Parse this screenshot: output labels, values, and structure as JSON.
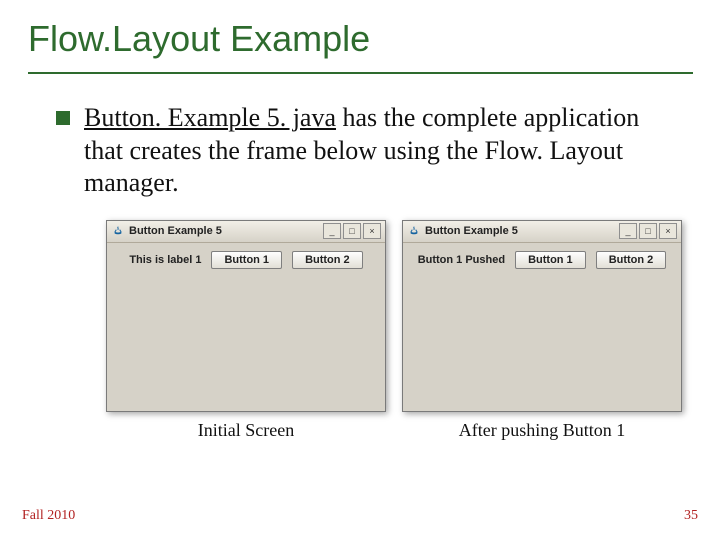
{
  "title": "Flow.Layout Example",
  "body": {
    "link_text": "Button. Example 5. java",
    "rest_text": " has the complete application that creates the frame below using the Flow. Layout manager."
  },
  "figures": {
    "left": {
      "window_title": "Button Example 5",
      "label": "This is label 1",
      "button1": "Button 1",
      "button2": "Button 2",
      "caption": "Initial Screen"
    },
    "right": {
      "window_title": "Button Example 5",
      "label": "Button 1 Pushed",
      "button1": "Button 1",
      "button2": "Button 2",
      "caption": "After pushing Button 1"
    }
  },
  "window_controls": {
    "min": "_",
    "max": "□",
    "close": "×"
  },
  "footer": {
    "left": "Fall 2010",
    "right": "35"
  }
}
